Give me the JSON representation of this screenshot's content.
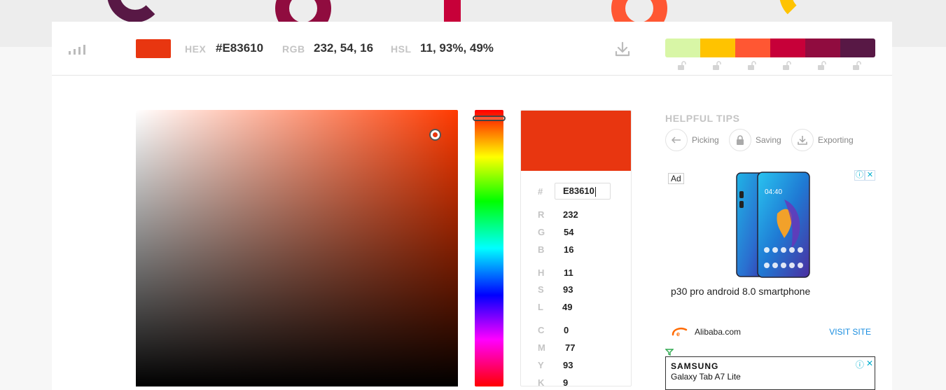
{
  "current_color": {
    "hex": "#E83610",
    "hex_input": "E83610",
    "rgb": "232, 54, 16",
    "hsl": "11, 93%, 49%",
    "swatch": "#e83610",
    "sv_base": "#ff3a00"
  },
  "header": {
    "hex_label": "HEX",
    "rgb_label": "RGB",
    "hsl_label": "HSL"
  },
  "palette": [
    "#d8f6a6",
    "#ffc300",
    "#ff5733",
    "#c70039",
    "#900c3f",
    "#581845"
  ],
  "top_decor": [
    "#581845",
    "#900c3f",
    "#c70039",
    "#ff5733",
    "#ffc300"
  ],
  "values": {
    "hash": "#",
    "R": "232",
    "G": "54",
    "B": "16",
    "H": "11",
    "S": "93",
    "L": "49",
    "C": "0",
    "M": "77",
    "Y": "93",
    "K": "9"
  },
  "tips": {
    "title": "HELPFUL TIPS",
    "items": [
      {
        "label": "Picking",
        "icon": "arrow-left-icon"
      },
      {
        "label": "Saving",
        "icon": "lock-icon"
      },
      {
        "label": "Exporting",
        "icon": "download-icon"
      }
    ]
  },
  "ad": {
    "badge": "Ad",
    "title": "p30 pro android 8.0 smartphone",
    "brand": "Alibaba.com",
    "cta": "VISIT SITE",
    "info_glyph": "ⓘ",
    "close_glyph": "✕"
  },
  "ad2": {
    "brand": "SAMSUNG",
    "product": "Galaxy Tab A7 Lite"
  }
}
